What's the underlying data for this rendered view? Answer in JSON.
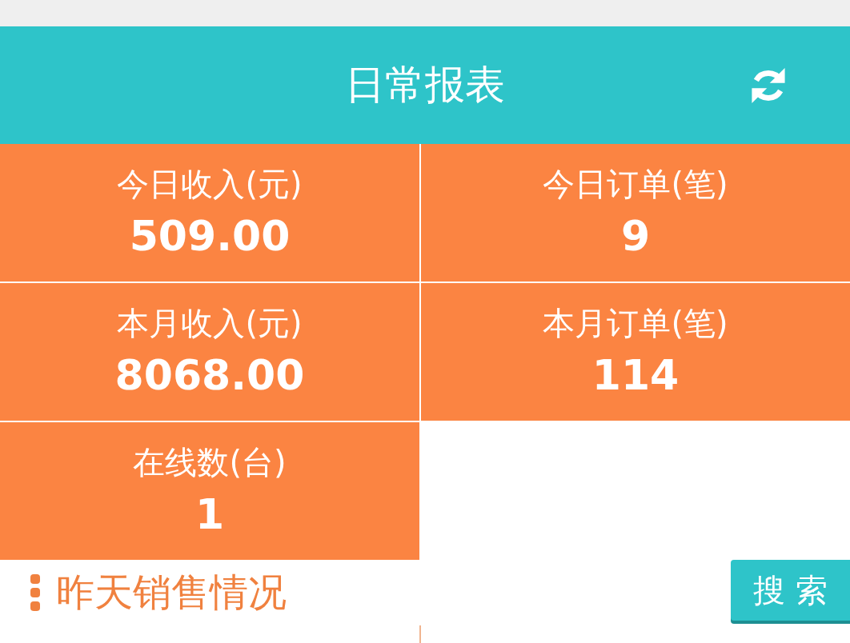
{
  "header": {
    "title": "日常报表"
  },
  "stats": [
    {
      "label": "今日收入(元)",
      "value": "509.00"
    },
    {
      "label": "今日订单(笔)",
      "value": "9"
    },
    {
      "label": "本月收入(元)",
      "value": "8068.00"
    },
    {
      "label": "本月订单(笔)",
      "value": "114"
    },
    {
      "label": "在线数(台)",
      "value": "1"
    }
  ],
  "section": {
    "title": "昨天销售情况",
    "search_button": "搜 索"
  }
}
